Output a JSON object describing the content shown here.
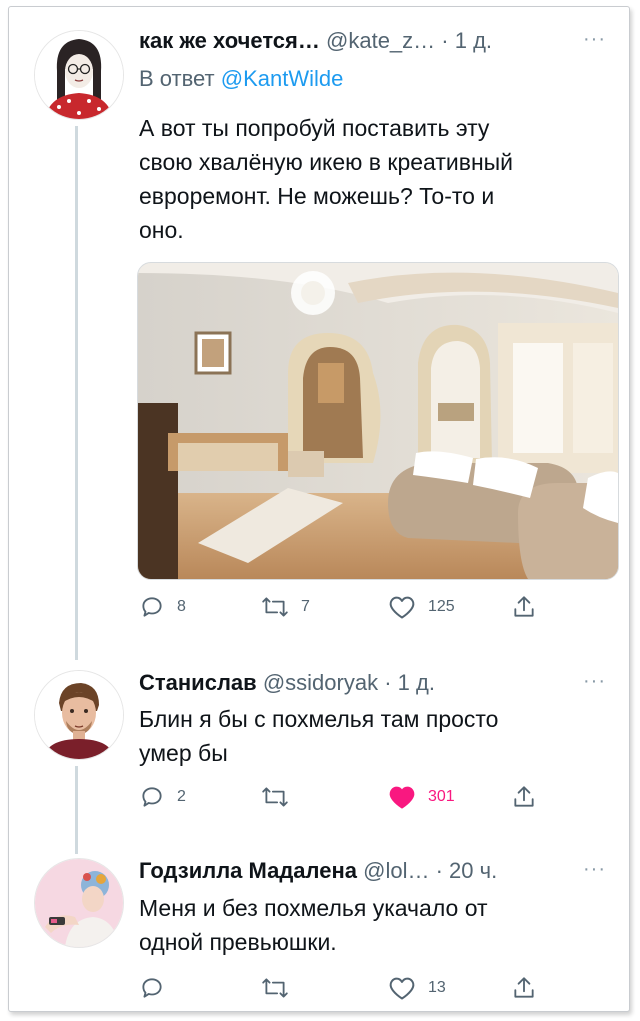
{
  "tweets": [
    {
      "name": "как же хочется…",
      "handle": "@kate_z…",
      "dot": "·",
      "time": "1 д.",
      "reply_prefix": "В ответ",
      "reply_mention": "@KantWilde",
      "text_lines": [
        "А вот ты попробуй поставить эту",
        "свою хвалёную икею в креативный",
        "евроремонт. Не можешь? То-то и",
        "оно."
      ],
      "actions": {
        "replies": "8",
        "retweets": "7",
        "likes": "125"
      },
      "liked": false
    },
    {
      "name": "Станислав",
      "handle": "@ssidoryak",
      "dot": "·",
      "time": "1 д.",
      "text_lines": [
        "Блин я бы с похмелья там просто",
        "умер бы"
      ],
      "actions": {
        "replies": "2",
        "retweets": "",
        "likes": "301"
      },
      "liked": true
    },
    {
      "name": "Годзилла Мадалена",
      "handle": "@lol…",
      "dot": "·",
      "time": "20 ч.",
      "text_lines": [
        "Меня и без похмелья укачало от",
        "одной превьюшки."
      ],
      "actions": {
        "replies": "",
        "retweets": "",
        "likes": "13"
      },
      "liked": false
    }
  ],
  "more_label": "···",
  "icons": [
    "reply-icon",
    "retweet-icon",
    "like-icon",
    "share-icon",
    "more-icon"
  ],
  "colors": {
    "link": "#1d9bf0",
    "muted": "#536471",
    "like_active": "#f91880",
    "thread_line": "#cfd9de"
  }
}
